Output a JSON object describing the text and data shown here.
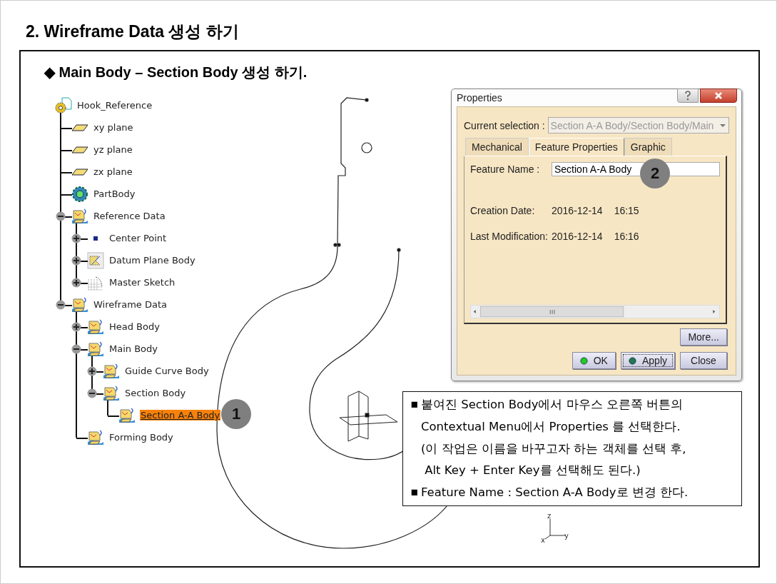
{
  "title": "2. Wireframe Data 생성 하기",
  "subtitle": "◆ Main Body – Section Body 생성 하기.",
  "tree": {
    "label": "Hook_Reference",
    "kind": "part",
    "selected": false,
    "children": [
      {
        "label": "xy plane",
        "kind": "plane",
        "selected": false
      },
      {
        "label": "yz plane",
        "kind": "plane",
        "selected": false
      },
      {
        "label": "zx plane",
        "kind": "plane",
        "selected": false
      },
      {
        "label": "PartBody",
        "kind": "partbody",
        "selected": false
      },
      {
        "label": "Reference Data",
        "kind": "geoset",
        "selected": false,
        "expanded": true,
        "children": [
          {
            "label": "Center Point",
            "kind": "point",
            "selected": false,
            "expanded": false
          },
          {
            "label": "Datum Plane Body",
            "kind": "datum",
            "selected": false,
            "expanded": false
          },
          {
            "label": "Master Sketch",
            "kind": "sketch",
            "selected": false,
            "expanded": false
          }
        ]
      },
      {
        "label": "Wireframe Data",
        "kind": "geoset",
        "selected": false,
        "expanded": true,
        "children": [
          {
            "label": "Head Body",
            "kind": "geoset",
            "selected": false,
            "expanded": false
          },
          {
            "label": "Main Body",
            "kind": "geoset",
            "selected": false,
            "expanded": true,
            "children": [
              {
                "label": "Guide Curve Body",
                "kind": "geoset",
                "selected": false,
                "expanded": false
              },
              {
                "label": "Section Body",
                "kind": "geoset",
                "selected": false,
                "expanded": true,
                "children": [
                  {
                    "label": "Section A-A Body",
                    "kind": "geoset",
                    "selected": true
                  }
                ]
              }
            ]
          },
          {
            "label": "Forming Body",
            "kind": "geoset",
            "selected": false
          }
        ]
      }
    ]
  },
  "axis_labels": [
    "z",
    "y",
    "x"
  ],
  "dialog": {
    "title": "Properties",
    "selection_label": "Current selection :",
    "selection_value": "Section A-A Body/Section Body/Main",
    "tabs": [
      {
        "label": "Mechanical",
        "selected": false
      },
      {
        "label": "Feature Properties",
        "selected": true
      },
      {
        "label": "Graphic",
        "selected": false
      }
    ],
    "fields": [
      {
        "kind": "input",
        "label": "Feature Name :",
        "value": "Section A-A Body"
      },
      {
        "kind": "info",
        "label": "Creation Date:",
        "value": "2016-12-14",
        "time": "16:15"
      },
      {
        "kind": "info",
        "label": "Last Modification:",
        "value": "2016-12-14",
        "time": "16:16"
      }
    ],
    "more_button": "More...",
    "buttons": [
      {
        "label": "OK",
        "kind": "ok"
      },
      {
        "label": "Apply",
        "kind": "apply"
      },
      {
        "label": "Close",
        "kind": "plain"
      }
    ]
  },
  "markers": [
    "1",
    "2"
  ],
  "notes": [
    {
      "marker": "▪",
      "text": "붙여진 Section Body에서 마우스 오른쪽 버튼의"
    },
    {
      "text": "Contextual Menu에서 Properties 를 선택한다."
    },
    {
      "text": "(이 작업은 이름을 바꾸고자 하는 객체를 선택 후,"
    },
    {
      "text": " Alt Key + Enter Key를 선택해도 된다.)"
    },
    {
      "marker": "▪",
      "text": "Feature Name : Section A-A Body로 변경 한다."
    }
  ]
}
